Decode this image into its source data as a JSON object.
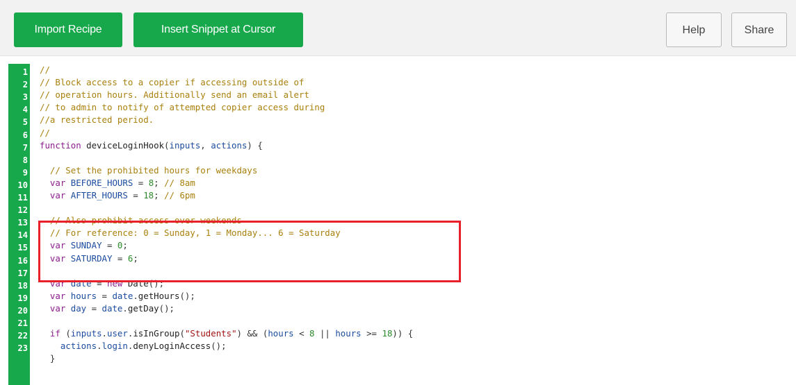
{
  "toolbar": {
    "import_label": "Import Recipe",
    "insert_label": "Insert Snippet at Cursor",
    "help_label": "Help",
    "share_label": "Share"
  },
  "colors": {
    "accent_green": "#16a84a",
    "highlight_red": "#e8202a"
  },
  "editor": {
    "line_numbers": [
      "1",
      "2",
      "3",
      "4",
      "5",
      "6",
      "7",
      "8",
      "9",
      "10",
      "11",
      "12",
      "13",
      "14",
      "15",
      "16",
      "17",
      "18",
      "19",
      "20",
      "21",
      "22",
      "23"
    ],
    "lines": [
      [
        {
          "t": "cm",
          "v": "//"
        }
      ],
      [
        {
          "t": "cm",
          "v": "// Block access to a copier if accessing outside of"
        }
      ],
      [
        {
          "t": "cm",
          "v": "// operation hours. Additionally send an email alert"
        }
      ],
      [
        {
          "t": "cm",
          "v": "// to admin to notify of attempted copier access during"
        }
      ],
      [
        {
          "t": "cm",
          "v": "//a restricted period."
        }
      ],
      [
        {
          "t": "cm",
          "v": "//"
        }
      ],
      [
        {
          "t": "kw",
          "v": "function "
        },
        {
          "t": "fn",
          "v": "deviceLoginHook"
        },
        {
          "t": "tx",
          "v": "("
        },
        {
          "t": "vr",
          "v": "inputs"
        },
        {
          "t": "tx",
          "v": ", "
        },
        {
          "t": "vr",
          "v": "actions"
        },
        {
          "t": "tx",
          "v": ") {"
        }
      ],
      [],
      [
        {
          "t": "tx",
          "v": "  "
        },
        {
          "t": "cm",
          "v": "// Set the prohibited hours for weekdays"
        }
      ],
      [
        {
          "t": "tx",
          "v": "  "
        },
        {
          "t": "kw",
          "v": "var "
        },
        {
          "t": "vr",
          "v": "BEFORE_HOURS"
        },
        {
          "t": "tx",
          "v": " = "
        },
        {
          "t": "nm",
          "v": "8"
        },
        {
          "t": "tx",
          "v": "; "
        },
        {
          "t": "cm",
          "v": "// 8am"
        }
      ],
      [
        {
          "t": "tx",
          "v": "  "
        },
        {
          "t": "kw",
          "v": "var "
        },
        {
          "t": "vr",
          "v": "AFTER_HOURS"
        },
        {
          "t": "tx",
          "v": " = "
        },
        {
          "t": "nm",
          "v": "18"
        },
        {
          "t": "tx",
          "v": "; "
        },
        {
          "t": "cm",
          "v": "// 6pm"
        }
      ],
      [],
      [
        {
          "t": "tx",
          "v": "  "
        },
        {
          "t": "cm",
          "v": "// Also prohibit access over weekends"
        }
      ],
      [
        {
          "t": "tx",
          "v": "  "
        },
        {
          "t": "cm",
          "v": "// For reference: 0 = Sunday, 1 = Monday... 6 = Saturday"
        }
      ],
      [
        {
          "t": "tx",
          "v": "  "
        },
        {
          "t": "kw",
          "v": "var "
        },
        {
          "t": "vr",
          "v": "SUNDAY"
        },
        {
          "t": "tx",
          "v": " = "
        },
        {
          "t": "nm",
          "v": "0"
        },
        {
          "t": "tx",
          "v": ";"
        }
      ],
      [
        {
          "t": "tx",
          "v": "  "
        },
        {
          "t": "kw",
          "v": "var "
        },
        {
          "t": "vr",
          "v": "SATURDAY"
        },
        {
          "t": "tx",
          "v": " = "
        },
        {
          "t": "nm",
          "v": "6"
        },
        {
          "t": "tx",
          "v": ";"
        }
      ],
      [],
      [
        {
          "t": "tx",
          "v": "  "
        },
        {
          "t": "kw",
          "v": "var "
        },
        {
          "t": "vr",
          "v": "date"
        },
        {
          "t": "tx",
          "v": " = "
        },
        {
          "t": "kw",
          "v": "new "
        },
        {
          "t": "fn",
          "v": "Date"
        },
        {
          "t": "tx",
          "v": "();"
        }
      ],
      [
        {
          "t": "tx",
          "v": "  "
        },
        {
          "t": "kw",
          "v": "var "
        },
        {
          "t": "vr",
          "v": "hours"
        },
        {
          "t": "tx",
          "v": " = "
        },
        {
          "t": "vr",
          "v": "date"
        },
        {
          "t": "tx",
          "v": "."
        },
        {
          "t": "fn",
          "v": "getHours"
        },
        {
          "t": "tx",
          "v": "();"
        }
      ],
      [
        {
          "t": "tx",
          "v": "  "
        },
        {
          "t": "kw",
          "v": "var "
        },
        {
          "t": "vr",
          "v": "day"
        },
        {
          "t": "tx",
          "v": " = "
        },
        {
          "t": "vr",
          "v": "date"
        },
        {
          "t": "tx",
          "v": "."
        },
        {
          "t": "fn",
          "v": "getDay"
        },
        {
          "t": "tx",
          "v": "();"
        }
      ],
      [],
      [
        {
          "t": "tx",
          "v": "  "
        },
        {
          "t": "kw",
          "v": "if "
        },
        {
          "t": "tx",
          "v": "("
        },
        {
          "t": "vr",
          "v": "inputs"
        },
        {
          "t": "tx",
          "v": "."
        },
        {
          "t": "vr",
          "v": "user"
        },
        {
          "t": "tx",
          "v": "."
        },
        {
          "t": "fn",
          "v": "isInGroup"
        },
        {
          "t": "tx",
          "v": "("
        },
        {
          "t": "st",
          "v": "\"Students\""
        },
        {
          "t": "tx",
          "v": ") && ("
        },
        {
          "t": "vr",
          "v": "hours"
        },
        {
          "t": "tx",
          "v": " < "
        },
        {
          "t": "nm",
          "v": "8"
        },
        {
          "t": "tx",
          "v": " || "
        },
        {
          "t": "vr",
          "v": "hours"
        },
        {
          "t": "tx",
          "v": " >= "
        },
        {
          "t": "nm",
          "v": "18"
        },
        {
          "t": "tx",
          "v": ")) {"
        }
      ],
      [
        {
          "t": "tx",
          "v": "    "
        },
        {
          "t": "vr",
          "v": "actions"
        },
        {
          "t": "tx",
          "v": "."
        },
        {
          "t": "vr",
          "v": "login"
        },
        {
          "t": "tx",
          "v": "."
        },
        {
          "t": "fn",
          "v": "denyLoginAccess"
        },
        {
          "t": "tx",
          "v": "();"
        }
      ],
      [
        {
          "t": "tx",
          "v": "  }"
        }
      ]
    ]
  }
}
